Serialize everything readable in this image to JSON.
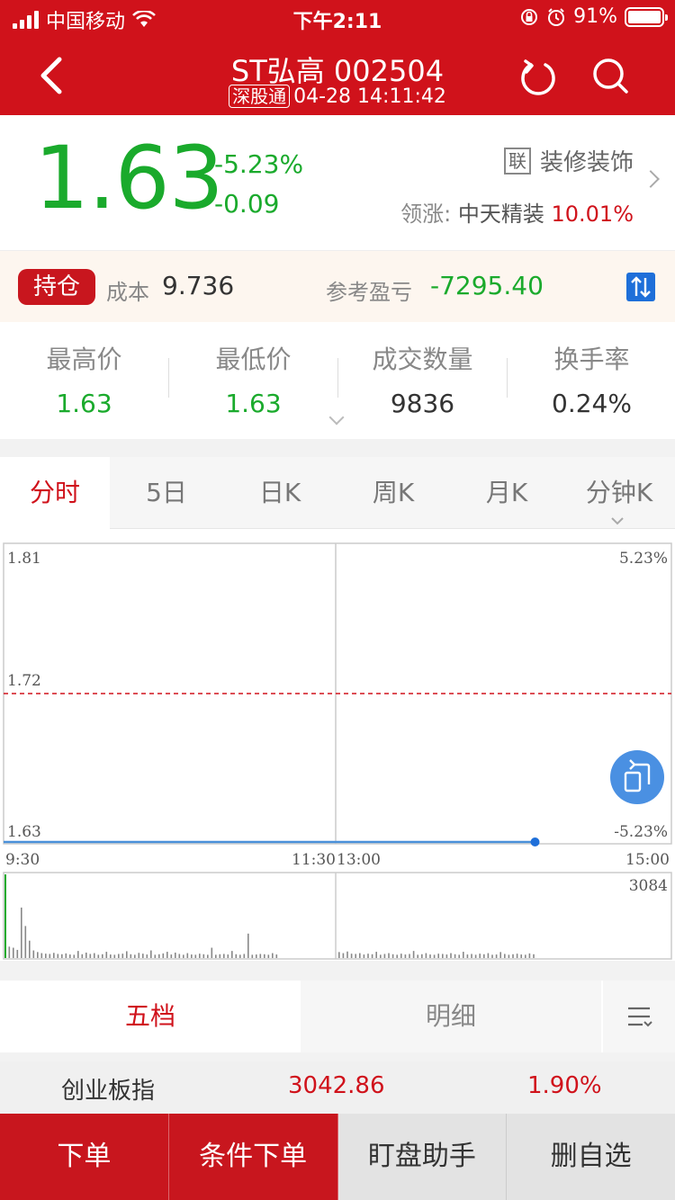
{
  "status_bar": {
    "carrier": "中国移动",
    "time": "下午2:11",
    "battery": "91%"
  },
  "nav": {
    "title": "ST弘高 002504",
    "exchange_tag": "深股通",
    "datetime": "04-28 14:11:42"
  },
  "quote": {
    "price": "1.63",
    "change_pct": "-5.23%",
    "change": "-0.09",
    "sector_badge": "联",
    "sector": "装修装饰",
    "leader_label": "领涨:",
    "leader_name": "中天精装",
    "leader_pct": "10.01%"
  },
  "position": {
    "badge": "持仓",
    "cost_label": "成本",
    "cost": "9.736",
    "pl_label": "参考盈亏",
    "pl": "-7295.40"
  },
  "stats": [
    {
      "label": "最高价",
      "value": "1.63",
      "color": "#1aaa2c"
    },
    {
      "label": "最低价",
      "value": "1.63",
      "color": "#1aaa2c"
    },
    {
      "label": "成交数量",
      "value": "9836",
      "color": "#333333"
    },
    {
      "label": "换手率",
      "value": "0.24%",
      "color": "#333333"
    }
  ],
  "chart_tabs": [
    "分时",
    "5日",
    "日K",
    "周K",
    "月K",
    "分钟K"
  ],
  "chart_data": {
    "type": "line",
    "price_axis": {
      "top": "1.81",
      "mid": "1.72",
      "bottom": "1.63"
    },
    "pct_axis": {
      "top": "5.23%",
      "bottom": "-5.23%"
    },
    "time_labels": [
      "9:30",
      "11:30",
      "13:00",
      "15:00"
    ],
    "ylim": [
      1.63,
      1.81
    ],
    "reference_price": 1.72,
    "series": [
      {
        "x_start": "9:30",
        "x_end": "14:11",
        "values": [
          1.63,
          1.63
        ]
      }
    ],
    "volume_max_label": "3084",
    "volume_max": 3084,
    "volume_morning": [
      3084,
      420,
      380,
      300,
      1860,
      1180,
      640,
      280,
      220,
      180,
      160,
      150,
      190,
      150,
      140,
      170,
      130,
      120,
      260,
      140,
      200,
      150,
      180,
      120,
      140,
      230,
      130,
      120,
      150,
      160,
      250,
      140,
      120,
      190,
      160,
      130,
      280,
      120,
      140,
      170,
      230,
      130,
      200,
      150,
      120,
      180,
      130,
      120,
      160,
      140,
      120,
      380,
      120,
      140,
      150,
      130,
      260,
      140,
      120,
      150,
      900,
      120,
      130,
      150,
      140,
      120,
      180,
      130
    ],
    "volume_afternoon": [
      220,
      180,
      240,
      160,
      150,
      180,
      130,
      160,
      140,
      230,
      120,
      150,
      180,
      140,
      120,
      160,
      130,
      150,
      260,
      120,
      140,
      180,
      130,
      120,
      160,
      150,
      130,
      180,
      140,
      120,
      230,
      130,
      150,
      120,
      160,
      140,
      180,
      120,
      130,
      220,
      150,
      120,
      140,
      160,
      130,
      120,
      170,
      140
    ]
  },
  "colors": {
    "brand_red": "#d0121b",
    "down_green": "#1aaa2c",
    "line_blue": "#4a90d9",
    "accent_blue": "#1e6fd9"
  },
  "depth_tabs": {
    "five_level": "五档",
    "detail": "明细"
  },
  "index_row": {
    "name": "创业板指",
    "value": "3042.86",
    "pct": "1.90%"
  },
  "bottom_bar": {
    "order": "下单",
    "conditional_order": "条件下单",
    "monitor": "盯盘助手",
    "remove_watch": "删自选"
  }
}
